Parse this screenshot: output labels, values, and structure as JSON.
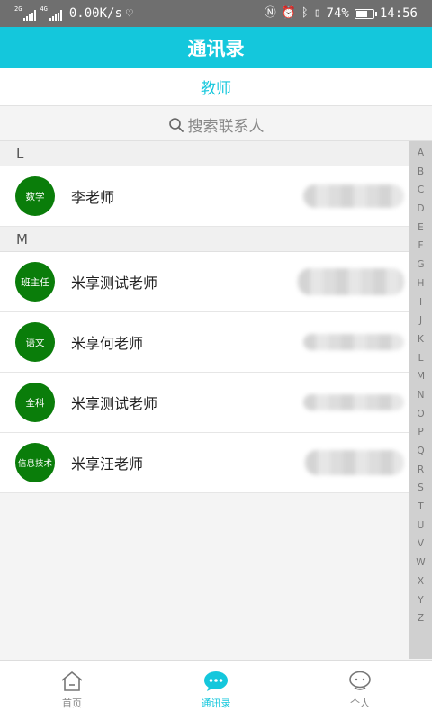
{
  "status_bar": {
    "net_left": "2G",
    "net_right": "4G",
    "speed": "0.00K/s",
    "battery_text": "74%",
    "time": "14:56",
    "battery_level": 0.74
  },
  "header": {
    "title": "通讯录"
  },
  "tab": {
    "label": "教师"
  },
  "search": {
    "placeholder": "搜索联系人"
  },
  "sections": [
    {
      "letter": "L",
      "contacts": [
        {
          "avatar": "数学",
          "name": "李老师"
        }
      ]
    },
    {
      "letter": "M",
      "contacts": [
        {
          "avatar": "班主任",
          "name": "米享测试老师"
        },
        {
          "avatar": "语文",
          "name": "米享何老师"
        },
        {
          "avatar": "全科",
          "name": "米享测试老师"
        },
        {
          "avatar": "信息技术",
          "name": "米享汪老师"
        }
      ]
    }
  ],
  "index_letters": [
    "A",
    "B",
    "C",
    "D",
    "E",
    "F",
    "G",
    "H",
    "I",
    "J",
    "K",
    "L",
    "M",
    "N",
    "O",
    "P",
    "Q",
    "R",
    "S",
    "T",
    "U",
    "V",
    "W",
    "X",
    "Y",
    "Z"
  ],
  "bottom_nav": [
    {
      "label": "首页",
      "icon": "home-icon",
      "active": false
    },
    {
      "label": "通讯录",
      "icon": "chat-icon",
      "active": true
    },
    {
      "label": "个人",
      "icon": "person-icon",
      "active": false
    }
  ],
  "colors": {
    "accent": "#14c7dc",
    "avatar_bg": "#0a7d0a"
  }
}
